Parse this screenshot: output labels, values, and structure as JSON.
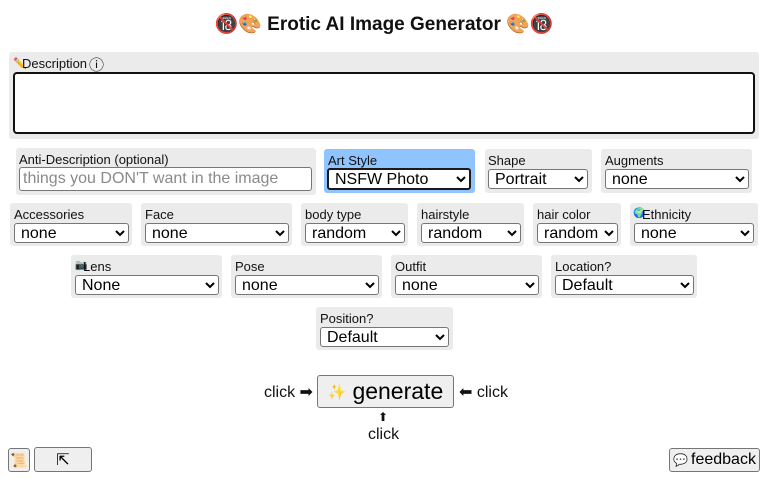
{
  "title": "🔞🎨 Erotic AI Image Generator 🎨🔞",
  "description": {
    "icon": "✏️",
    "label": "Description",
    "info_icon": "ⓘ",
    "value": ""
  },
  "anti_description": {
    "label": "Anti-Description (optional)",
    "placeholder": "things you DON'T want in the image"
  },
  "art_style": {
    "label": "Art Style",
    "value": "NSFW Photo"
  },
  "shape": {
    "label": "Shape",
    "value": "Portrait"
  },
  "augments": {
    "label": "Augments",
    "value": "none"
  },
  "accessories": {
    "label": "Accessories",
    "value": "none"
  },
  "face": {
    "label": "Face",
    "value": "none"
  },
  "body_type": {
    "label": "body type",
    "value": "random"
  },
  "hairstyle": {
    "label": "hairstyle",
    "value": "random"
  },
  "hair_color": {
    "label": "hair color",
    "value": "random"
  },
  "ethnicity": {
    "icon": "🌍",
    "label": "Ethnicity",
    "value": "none"
  },
  "lens": {
    "icon": "📷",
    "label": "Lens",
    "value": "None"
  },
  "pose": {
    "label": "Pose",
    "value": "none"
  },
  "outfit": {
    "label": "Outfit",
    "value": "none"
  },
  "location": {
    "label": "Location?",
    "value": "Default"
  },
  "position": {
    "label": "Position?",
    "value": "Default"
  },
  "generate": {
    "sparkle": "✨",
    "label": "generate"
  },
  "hints": {
    "left": "click ➡",
    "right": "⬅ click",
    "below_arrow": "⬆",
    "below": "click"
  },
  "bottom": {
    "left_icon": "📜",
    "expand_icon": "⇱",
    "feedback_icon": "💬",
    "feedback_label": "feedback"
  },
  "colors": {
    "field_bg": "#ebebeb",
    "highlight": "#90c4ff"
  }
}
